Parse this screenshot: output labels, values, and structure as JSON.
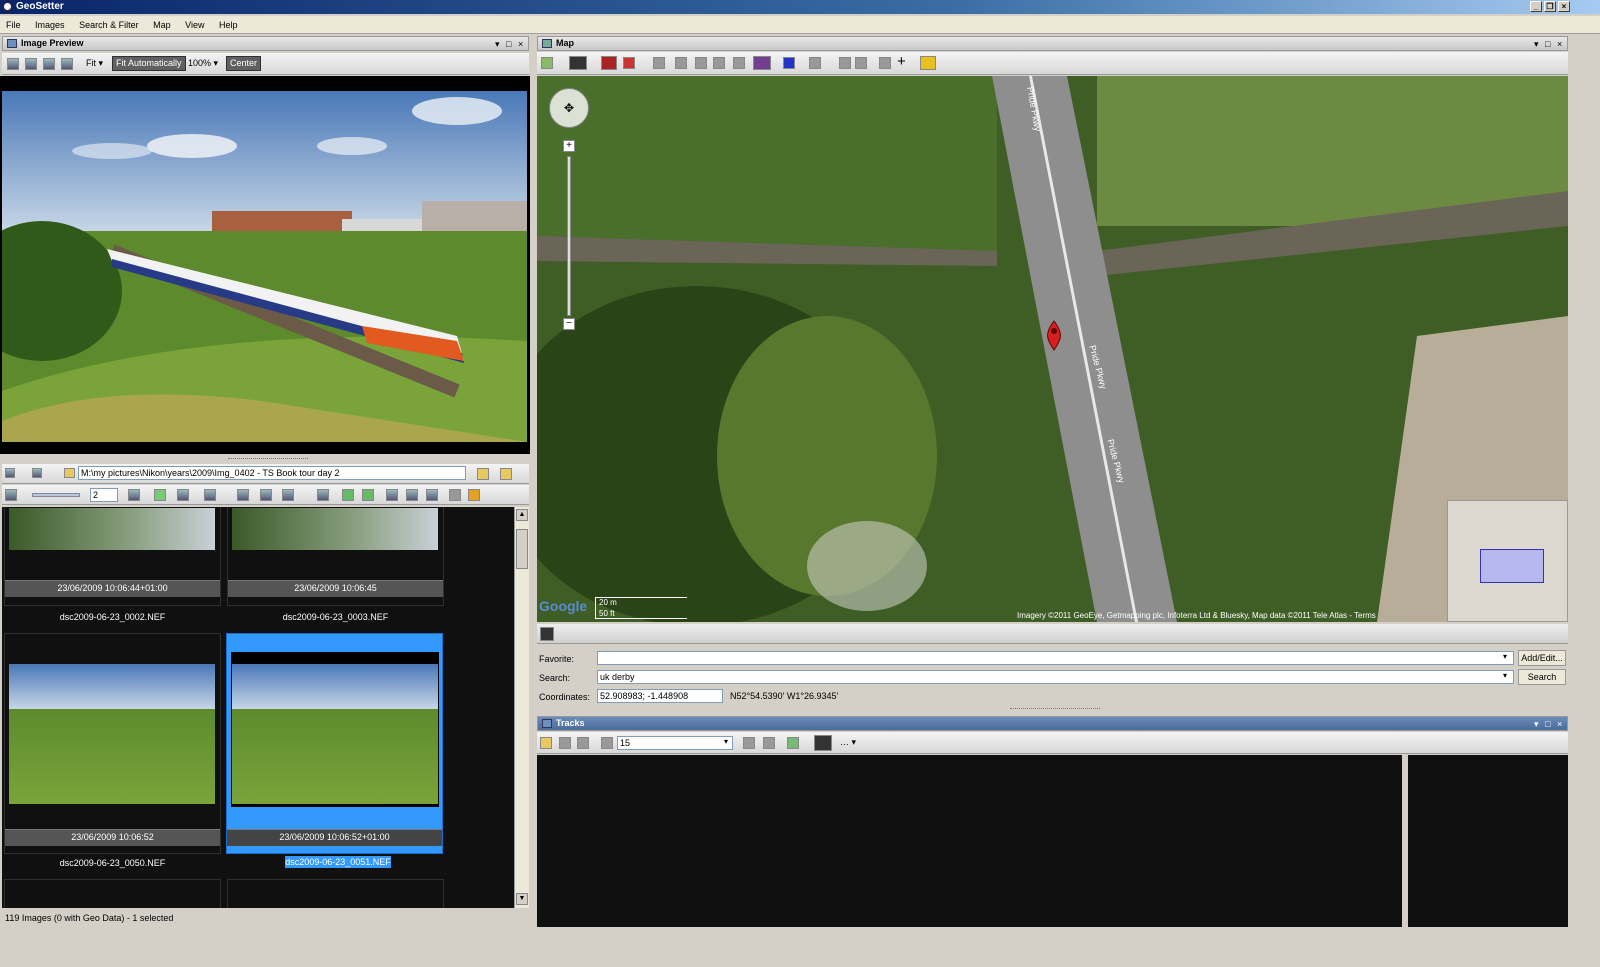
{
  "app": {
    "title": "GeoSetter"
  },
  "menu": [
    "File",
    "Images",
    "Search & Filter",
    "Map",
    "View",
    "Help"
  ],
  "image_preview": {
    "title": "Image Preview",
    "fit_label": "Fit",
    "fit_auto_label": "Fit Automatically",
    "zoom": "100%",
    "center_label": "Center"
  },
  "browser": {
    "path": "M:\\my pictures\\Nikon\\years\\2009\\Img_0402 - TS Book tour day 2",
    "spin_value": "2",
    "thumbnails": [
      {
        "date": "23/06/2009 10:06:44+01:00",
        "file": "dsc2009-06-23_0002.NEF"
      },
      {
        "date": "23/06/2009 10:06:45",
        "file": "dsc2009-06-23_0003.NEF"
      },
      {
        "date": "23/06/2009 10:06:52",
        "file": "dsc2009-06-23_0050.NEF"
      },
      {
        "date": "23/06/2009 10:06:52+01:00",
        "file": "dsc2009-06-23_0051.NEF"
      }
    ],
    "status": "119 Images (0 with Geo Data) - 1 selected"
  },
  "map": {
    "title": "Map",
    "scale_m": "20 m",
    "scale_ft": "50 ft",
    "attribution": "Imagery ©2011 GeoEye, Getmapping plc, Infoterra Ltd & Bluesky, Map data ©2011 Tele Atlas - Terms",
    "google": "Google",
    "road_labels": [
      "Pride Pkwy",
      "Pride Pkwy",
      "Pride Pkwy"
    ],
    "favorite_label": "Favorite:",
    "favorite_value": "",
    "add_edit_label": "Add/Edit...",
    "search_label": "Search:",
    "search_value": "uk derby",
    "search_button": "Search",
    "coordinates_label": "Coordinates:",
    "coordinates_value": "52.908983; -1.448908",
    "coordinates_dms": "N52°54.5390' W1°26.9345'"
  },
  "tracks": {
    "title": "Tracks",
    "combo_value": "15"
  },
  "colors": {
    "selection": "#3399ff",
    "panel_bg": "#d4d0c8",
    "dark_bg": "#101010"
  }
}
